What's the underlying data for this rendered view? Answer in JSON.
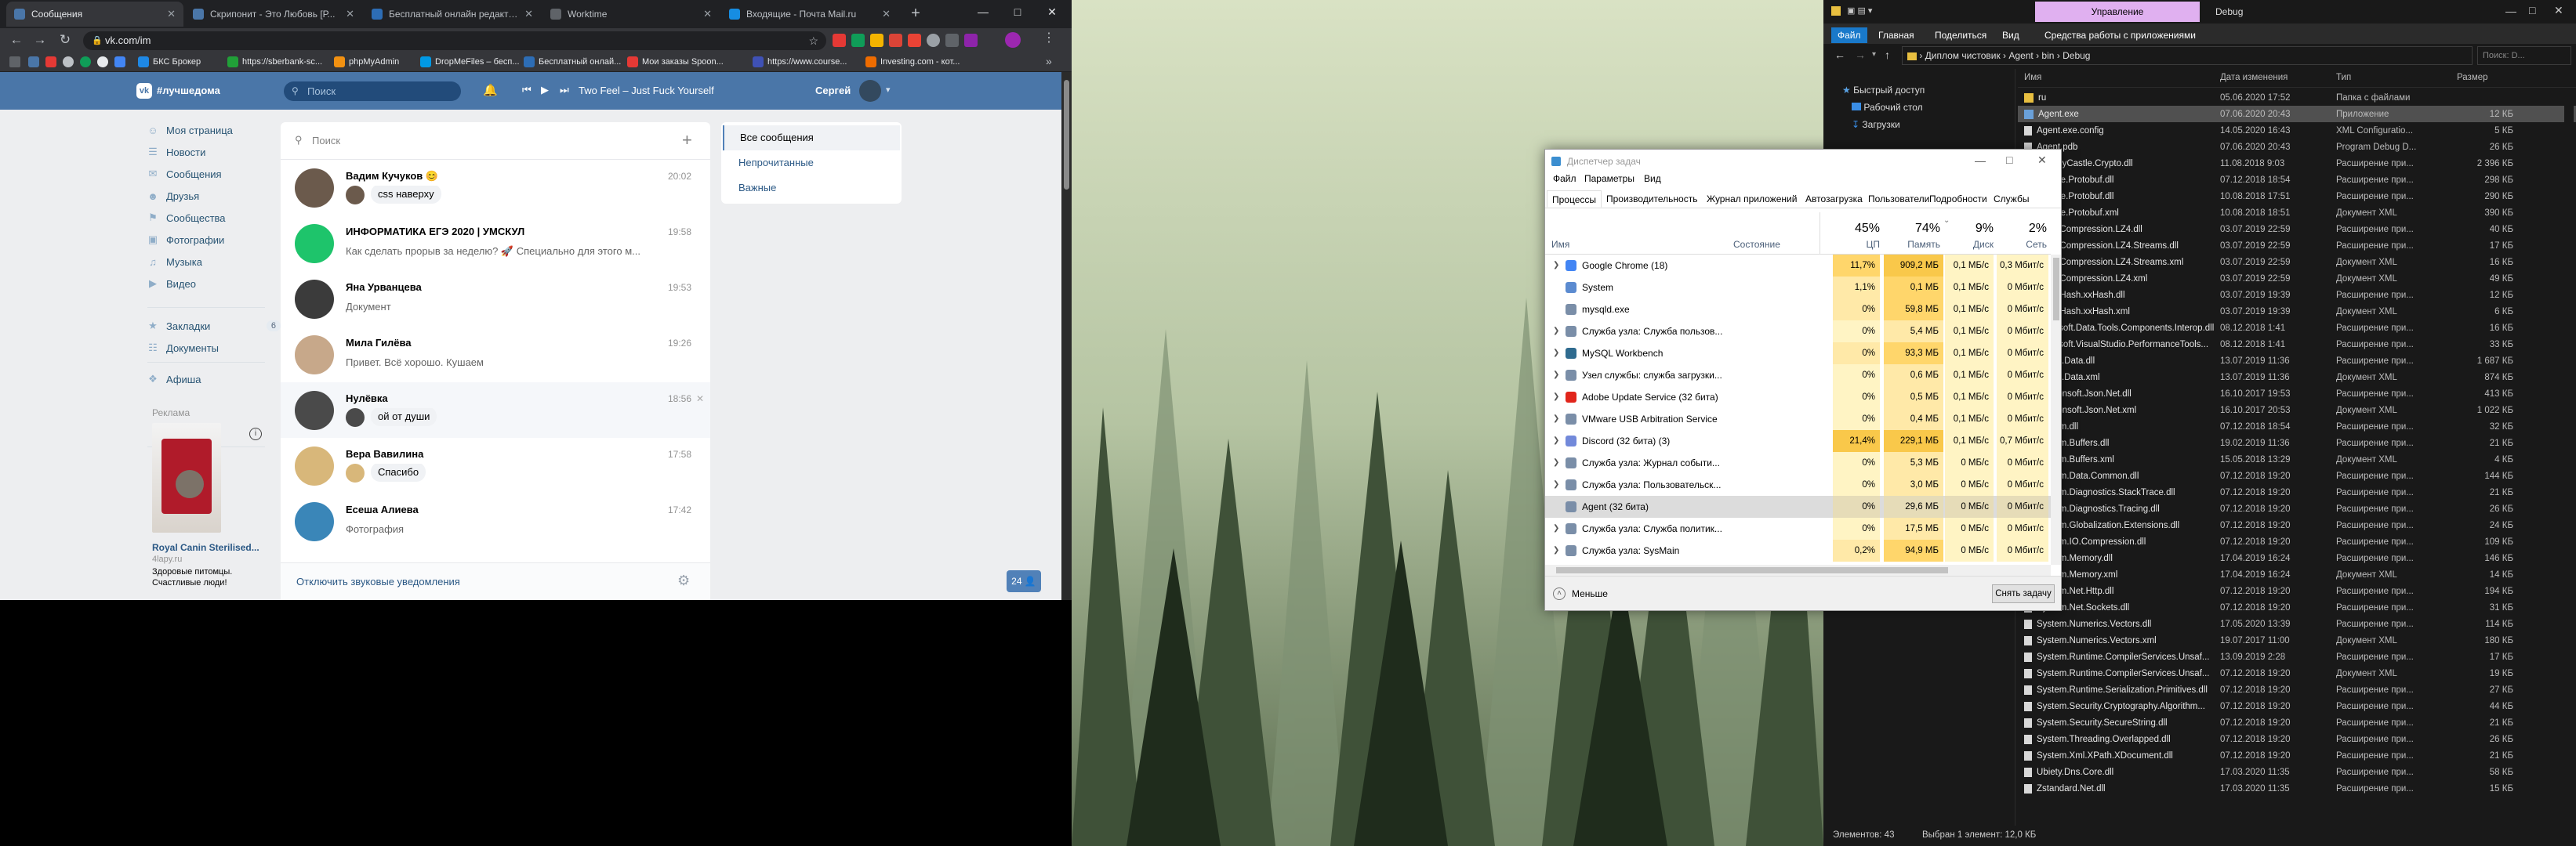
{
  "chrome": {
    "tabs": [
      {
        "label": "Сообщения",
        "color": "#4a76a8"
      },
      {
        "label": "Скрипонит - Это Любовь [Р...",
        "color": "#4a76a8"
      },
      {
        "label": "Бесплатный онлайн редакто...",
        "color": "#2d6db5"
      },
      {
        "label": "Worktime",
        "color": "#5f6368"
      },
      {
        "label": "Входящие - Почта Mail.ru",
        "color": "#168de2"
      }
    ],
    "new_tab": "+",
    "url": "vk.com/im",
    "bookmarks": [
      "БКС Брокер",
      "https://sberbank-sc...",
      "phpMyAdmin",
      "DropMeFiles – бесп...",
      "Бесплатный онлай...",
      "Мои заказы Spoon...",
      "https://www.course...",
      "Investing.com - кот..."
    ],
    "bookmark_colors": [
      "#1e88e5",
      "#21a038",
      "#f29111",
      "#0099e5",
      "#2d6db5",
      "#e53935",
      "#3f51b5",
      "#ef6c00"
    ]
  },
  "vk": {
    "logo": "#лучшедома",
    "search_placeholder": "Поиск",
    "player_track": "Two Feel – Just Fuck Yourself",
    "user_name": "Сергей",
    "menu": [
      {
        "label": "Моя страница",
        "icon": "user-icon"
      },
      {
        "label": "Новости",
        "icon": "news-icon"
      },
      {
        "label": "Сообщения",
        "icon": "message-icon"
      },
      {
        "label": "Друзья",
        "icon": "friends-icon"
      },
      {
        "label": "Сообщества",
        "icon": "groups-icon"
      },
      {
        "label": "Фотографии",
        "icon": "camera-icon"
      },
      {
        "label": "Музыка",
        "icon": "music-icon"
      },
      {
        "label": "Видео",
        "icon": "video-icon"
      }
    ],
    "menu2": [
      {
        "label": "Закладки",
        "icon": "star-icon",
        "badge": "6"
      },
      {
        "label": "Документы",
        "icon": "document-icon",
        "badge": ""
      }
    ],
    "menu3": [
      {
        "label": "Афиша",
        "icon": "ticket-icon"
      }
    ],
    "ads_label": "Реклама",
    "ad": {
      "title": "Royal Canin Sterilised...",
      "domain": "4lapy.ru",
      "text1": "Здоровые питомцы.",
      "text2": "Счастливые люди!"
    },
    "dialog_search": "Поиск",
    "dialogs": [
      {
        "name": "Вадим Кучуков 😊",
        "time": "20:02",
        "msg": "css наверху",
        "mini": true,
        "av": "#6b5a4c"
      },
      {
        "name": "ИНФОРМАТИКА ЕГЭ 2020 | УМСКУЛ",
        "time": "19:58",
        "msg": "Как сделать прорыв за неделю? 🚀 Специально для этого м...",
        "mini": false,
        "av": "#1ec46b"
      },
      {
        "name": "Яна Урванцева",
        "time": "19:53",
        "msg": "Документ",
        "mini": false,
        "av": "#3b3b3b"
      },
      {
        "name": "Мила Гилёва",
        "time": "19:26",
        "msg": "Привет. Всё хорошо. Кушаем",
        "mini": false,
        "av": "#c7a88a"
      },
      {
        "name": "Нулёвка",
        "time": "18:56",
        "msg": "ой от души",
        "mini": true,
        "av": "#4a4a4a"
      },
      {
        "name": "Вера Вавилина",
        "time": "17:58",
        "msg": "Спасибо",
        "mini": true,
        "av": "#d8b77a"
      },
      {
        "name": "Есеша Алиева",
        "time": "17:42",
        "msg": "Фотография",
        "mini": false,
        "av": "#3a86b8"
      }
    ],
    "mute_link": "Отключить звуковые уведомления",
    "online_count": "24",
    "filters": [
      "Все сообщения",
      "Непрочитанные",
      "Важные"
    ]
  },
  "explorer": {
    "ribbon_manage": "Управление",
    "title": "Debug",
    "ribbon_tabs": [
      "Файл",
      "Главная",
      "Поделиться",
      "Вид",
      "Средства работы с приложениями"
    ],
    "path": [
      "Диплом чистовик",
      "Agent",
      "bin",
      "Debug"
    ],
    "search_placeholder": "Поиск: D...",
    "quick_access": [
      "Быстрый доступ",
      "Рабочий стол",
      "Загрузки"
    ],
    "headers": [
      "Имя",
      "Дата изменения",
      "Тип",
      "Размер"
    ],
    "files": [
      {
        "name": "ru",
        "date": "05.06.2020 17:52",
        "type": "Папка с файлами",
        "size": "",
        "kind": "folder"
      },
      {
        "name": "Agent.exe",
        "date": "07.06.2020 20:43",
        "type": "Приложение",
        "size": "12 КБ",
        "kind": "exe"
      },
      {
        "name": "Agent.exe.config",
        "date": "14.05.2020 16:43",
        "type": "XML Configuratio...",
        "size": "5 КБ",
        "kind": "file"
      },
      {
        "name": "Agent.pdb",
        "date": "07.06.2020 20:43",
        "type": "Program Debug D...",
        "size": "26 КБ",
        "kind": "file"
      },
      {
        "name": "BouncyCastle.Crypto.dll",
        "date": "11.08.2018 9:03",
        "type": "Расширение при...",
        "size": "2 396 КБ",
        "kind": "file"
      },
      {
        "name": "Google.Protobuf.dll",
        "date": "07.12.2018 18:54",
        "type": "Расширение при...",
        "size": "298 КБ",
        "kind": "file"
      },
      {
        "name": "Google.Protobuf.dll",
        "date": "10.08.2018 17:51",
        "type": "Расширение при...",
        "size": "290 КБ",
        "kind": "file"
      },
      {
        "name": "Google.Protobuf.xml",
        "date": "10.08.2018 18:51",
        "type": "Документ XML",
        "size": "390 КБ",
        "kind": "file"
      },
      {
        "name": "K4os.Compression.LZ4.dll",
        "date": "03.07.2019 22:59",
        "type": "Расширение при...",
        "size": "40 КБ",
        "kind": "file"
      },
      {
        "name": "K4os.Compression.LZ4.Streams.dll",
        "date": "03.07.2019 22:59",
        "type": "Расширение при...",
        "size": "17 КБ",
        "kind": "file"
      },
      {
        "name": "K4os.Compression.LZ4.Streams.xml",
        "date": "03.07.2019 22:59",
        "type": "Документ XML",
        "size": "16 КБ",
        "kind": "file"
      },
      {
        "name": "K4os.Compression.LZ4.xml",
        "date": "03.07.2019 22:59",
        "type": "Документ XML",
        "size": "49 КБ",
        "kind": "file"
      },
      {
        "name": "K4os.Hash.xxHash.dll",
        "date": "03.07.2019 19:39",
        "type": "Расширение при...",
        "size": "12 КБ",
        "kind": "file"
      },
      {
        "name": "K4os.Hash.xxHash.xml",
        "date": "03.07.2019 19:39",
        "type": "Документ XML",
        "size": "6 КБ",
        "kind": "file"
      },
      {
        "name": "Microsoft.Data.Tools.Components.Interop.dll",
        "date": "08.12.2018 1:41",
        "type": "Расширение при...",
        "size": "16 КБ",
        "kind": "file"
      },
      {
        "name": "Microsoft.VisualStudio.PerformanceTools...",
        "date": "08.12.2018 1:41",
        "type": "Расширение при...",
        "size": "33 КБ",
        "kind": "file"
      },
      {
        "name": "MySql.Data.dll",
        "date": "13.07.2019 11:36",
        "type": "Расширение при...",
        "size": "1 687 КБ",
        "kind": "file"
      },
      {
        "name": "MySql.Data.xml",
        "date": "13.07.2019 11:36",
        "type": "Документ XML",
        "size": "874 КБ",
        "kind": "file"
      },
      {
        "name": "Newtonsoft.Json.Net.dll",
        "date": "16.10.2017 19:53",
        "type": "Расширение при...",
        "size": "413 КБ",
        "kind": "file"
      },
      {
        "name": "Newtonsoft.Json.Net.xml",
        "date": "16.10.2017 20:53",
        "type": "Документ XML",
        "size": "1 022 КБ",
        "kind": "file"
      },
      {
        "name": "System.dll",
        "date": "07.12.2018 18:54",
        "type": "Расширение при...",
        "size": "32 КБ",
        "kind": "file"
      },
      {
        "name": "System.Buffers.dll",
        "date": "19.02.2019 11:36",
        "type": "Расширение при...",
        "size": "21 КБ",
        "kind": "file"
      },
      {
        "name": "System.Buffers.xml",
        "date": "15.05.2018 13:29",
        "type": "Документ XML",
        "size": "4 КБ",
        "kind": "file"
      },
      {
        "name": "System.Data.Common.dll",
        "date": "07.12.2018 19:20",
        "type": "Расширение при...",
        "size": "144 КБ",
        "kind": "file"
      },
      {
        "name": "System.Diagnostics.StackTrace.dll",
        "date": "07.12.2018 19:20",
        "type": "Расширение при...",
        "size": "21 КБ",
        "kind": "file"
      },
      {
        "name": "System.Diagnostics.Tracing.dll",
        "date": "07.12.2018 19:20",
        "type": "Расширение при...",
        "size": "26 КБ",
        "kind": "file"
      },
      {
        "name": "System.Globalization.Extensions.dll",
        "date": "07.12.2018 19:20",
        "type": "Расширение при...",
        "size": "24 КБ",
        "kind": "file"
      },
      {
        "name": "System.IO.Compression.dll",
        "date": "07.12.2018 19:20",
        "type": "Расширение при...",
        "size": "109 КБ",
        "kind": "file"
      },
      {
        "name": "System.Memory.dll",
        "date": "17.04.2019 16:24",
        "type": "Расширение при...",
        "size": "146 КБ",
        "kind": "file"
      },
      {
        "name": "System.Memory.xml",
        "date": "17.04.2019 16:24",
        "type": "Документ XML",
        "size": "14 КБ",
        "kind": "file"
      },
      {
        "name": "System.Net.Http.dll",
        "date": "07.12.2018 19:20",
        "type": "Расширение при...",
        "size": "194 КБ",
        "kind": "file"
      },
      {
        "name": "System.Net.Sockets.dll",
        "date": "07.12.2018 19:20",
        "type": "Расширение при...",
        "size": "31 КБ",
        "kind": "file"
      },
      {
        "name": "System.Numerics.Vectors.dll",
        "date": "17.05.2020 13:39",
        "type": "Расширение при...",
        "size": "114 КБ",
        "kind": "file"
      },
      {
        "name": "System.Numerics.Vectors.xml",
        "date": "19.07.2017 11:00",
        "type": "Документ XML",
        "size": "180 КБ",
        "kind": "file"
      },
      {
        "name": "System.Runtime.CompilerServices.Unsaf...",
        "date": "13.09.2019 2:28",
        "type": "Расширение при...",
        "size": "17 КБ",
        "kind": "file"
      },
      {
        "name": "System.Runtime.CompilerServices.Unsaf...",
        "date": "07.12.2018 19:20",
        "type": "Документ XML",
        "size": "19 КБ",
        "kind": "file"
      },
      {
        "name": "System.Runtime.Serialization.Primitives.dll",
        "date": "07.12.2018 19:20",
        "type": "Расширение при...",
        "size": "27 КБ",
        "kind": "file"
      },
      {
        "name": "System.Security.Cryptography.Algorithm...",
        "date": "07.12.2018 19:20",
        "type": "Расширение при...",
        "size": "44 КБ",
        "kind": "file"
      },
      {
        "name": "System.Security.SecureString.dll",
        "date": "07.12.2018 19:20",
        "type": "Расширение при...",
        "size": "21 КБ",
        "kind": "file"
      },
      {
        "name": "System.Threading.Overlapped.dll",
        "date": "07.12.2018 19:20",
        "type": "Расширение при...",
        "size": "26 КБ",
        "kind": "file"
      },
      {
        "name": "System.Xml.XPath.XDocument.dll",
        "date": "07.12.2018 19:20",
        "type": "Расширение при...",
        "size": "21 КБ",
        "kind": "file"
      },
      {
        "name": "Ubiety.Dns.Core.dll",
        "date": "17.03.2020 11:35",
        "type": "Расширение при...",
        "size": "58 КБ",
        "kind": "file"
      },
      {
        "name": "Zstandard.Net.dll",
        "date": "17.03.2020 11:35",
        "type": "Расширение при...",
        "size": "15 КБ",
        "kind": "file"
      }
    ],
    "status_items": "Элементов: 43",
    "status_selected": "Выбран 1 элемент: 12,0 КБ"
  },
  "taskmgr": {
    "title": "Диспетчер задач",
    "menu": [
      "Файл",
      "Параметры",
      "Вид"
    ],
    "tabs": [
      "Процессы",
      "Производительность",
      "Журнал приложений",
      "Автозагрузка",
      "Пользователи",
      "Подробности",
      "Службы"
    ],
    "col_name": "Имя",
    "col_state": "Состояние",
    "cpu_pct": "45%",
    "cpu_label": "ЦП",
    "mem_pct": "74%",
    "mem_label": "Память",
    "disk_pct": "9%",
    "disk_label": "Диск",
    "net_pct": "2%",
    "net_label": "Сеть",
    "processes": [
      {
        "name": "Google Chrome (18)",
        "cpu": "11,7%",
        "mem": "909,2 МБ",
        "disk": "0,1 МБ/с",
        "net": "0,3 Мбит/с",
        "exp": true,
        "icon": "#4285f4",
        "hl": 2
      },
      {
        "name": "System",
        "cpu": "1,1%",
        "mem": "0,1 МБ",
        "disk": "0,1 МБ/с",
        "net": "0 Мбит/с",
        "exp": false,
        "icon": "#5b8bd0",
        "hl": 1
      },
      {
        "name": "mysqld.exe",
        "cpu": "0%",
        "mem": "59,8 МБ",
        "disk": "0,1 МБ/с",
        "net": "0 Мбит/с",
        "exp": false,
        "icon": "#7a8ea8",
        "hl": 1
      },
      {
        "name": "Служба узла: Служба пользов...",
        "cpu": "0%",
        "mem": "5,4 МБ",
        "disk": "0,1 МБ/с",
        "net": "0 Мбит/с",
        "exp": true,
        "icon": "#7a8ea8",
        "hl": 0
      },
      {
        "name": "MySQL Workbench",
        "cpu": "0%",
        "mem": "93,3 МБ",
        "disk": "0,1 МБ/с",
        "net": "0 Мбит/с",
        "exp": true,
        "icon": "#2f6b8f",
        "hl": 1
      },
      {
        "name": "Узел службы: служба загрузки...",
        "cpu": "0%",
        "mem": "0,6 МБ",
        "disk": "0,1 МБ/с",
        "net": "0 Мбит/с",
        "exp": true,
        "icon": "#7a8ea8",
        "hl": 0
      },
      {
        "name": "Adobe Update Service (32 бита)",
        "cpu": "0%",
        "mem": "0,5 МБ",
        "disk": "0,1 МБ/с",
        "net": "0 Мбит/с",
        "exp": true,
        "icon": "#e1251b",
        "hl": 0
      },
      {
        "name": "VMware USB Arbitration Service",
        "cpu": "0%",
        "mem": "0,4 МБ",
        "disk": "0,1 МБ/с",
        "net": "0 Мбит/с",
        "exp": true,
        "icon": "#7a8ea8",
        "hl": 0
      },
      {
        "name": "Discord (32 бита) (3)",
        "cpu": "21,4%",
        "mem": "229,1 МБ",
        "disk": "0,1 МБ/с",
        "net": "0,7 Мбит/с",
        "exp": true,
        "icon": "#7289da",
        "hl": 3
      },
      {
        "name": "Служба узла: Журнал событи...",
        "cpu": "0%",
        "mem": "5,3 МБ",
        "disk": "0 МБ/с",
        "net": "0 Мбит/с",
        "exp": true,
        "icon": "#7a8ea8",
        "hl": 0
      },
      {
        "name": "Служба узла: Пользовательск...",
        "cpu": "0%",
        "mem": "3,0 МБ",
        "disk": "0 МБ/с",
        "net": "0 Мбит/с",
        "exp": true,
        "icon": "#7a8ea8",
        "hl": 0
      },
      {
        "name": "Agent (32 бита)",
        "cpu": "0%",
        "mem": "29,6 МБ",
        "disk": "0 МБ/с",
        "net": "0 Мбит/с",
        "exp": false,
        "icon": "#7a8ea8",
        "hl": 1,
        "sel": true
      },
      {
        "name": "Служба узла: Служба политик...",
        "cpu": "0%",
        "mem": "17,5 МБ",
        "disk": "0 МБ/с",
        "net": "0 Мбит/с",
        "exp": true,
        "icon": "#7a8ea8",
        "hl": 0
      },
      {
        "name": "Служба узла: SysMain",
        "cpu": "0,2%",
        "mem": "94,9 МБ",
        "disk": "0 МБ/с",
        "net": "0 Мбит/с",
        "exp": true,
        "icon": "#7a8ea8",
        "hl": 1
      }
    ],
    "less_label": "Меньше",
    "end_task": "Снять задачу"
  }
}
